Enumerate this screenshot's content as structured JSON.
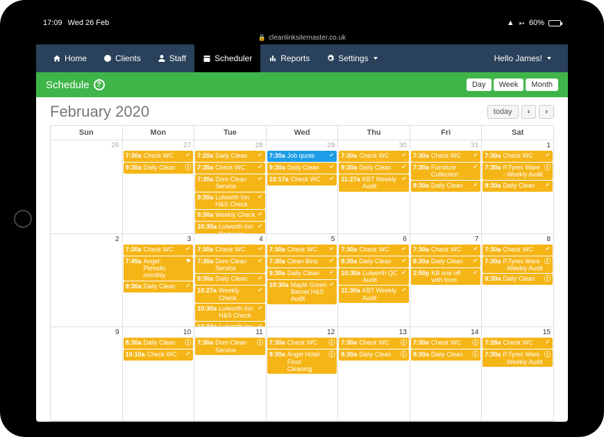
{
  "status": {
    "time": "17:09",
    "date": "Wed 26 Feb",
    "battery": "60%",
    "url": "cleanlinksitemaster.co.uk"
  },
  "nav": {
    "items": [
      {
        "label": "Home"
      },
      {
        "label": "Clients"
      },
      {
        "label": "Staff"
      },
      {
        "label": "Scheduler"
      },
      {
        "label": "Reports"
      },
      {
        "label": "Settings"
      }
    ],
    "greeting": "Hello James!"
  },
  "schedule_bar": {
    "title": "Schedule",
    "views": [
      "Day",
      "Week",
      "Month"
    ]
  },
  "calendar": {
    "title": "February 2020",
    "today_label": "today",
    "daynames": [
      "Sun",
      "Mon",
      "Tue",
      "Wed",
      "Thu",
      "Fri",
      "Sat"
    ],
    "weeks": [
      [
        {
          "num": "26",
          "cur": false,
          "events": []
        },
        {
          "num": "27",
          "cur": false,
          "events": [
            {
              "t": "7:30a",
              "txt": "Check WC",
              "ico": "check"
            },
            {
              "t": "9:30a",
              "txt": "Daily Clean",
              "ico": "info"
            }
          ]
        },
        {
          "num": "28",
          "cur": false,
          "events": [
            {
              "t": "7:20a",
              "txt": "Daily Clean",
              "ico": "check"
            },
            {
              "t": "7:30a",
              "txt": "Check WC",
              "ico": "check"
            },
            {
              "t": "7:30a",
              "txt": "Dom Clean Service",
              "ico": "check"
            },
            {
              "t": "9:30a",
              "txt": "Lulworth Inn H&S Check",
              "ico": "check"
            },
            {
              "t": "9:30a",
              "txt": "Weekly Check",
              "ico": "check"
            },
            {
              "t": "10:35a",
              "txt": "Lulworth Inn Bedroom Check",
              "ico": "check"
            }
          ]
        },
        {
          "num": "29",
          "cur": false,
          "events": [
            {
              "t": "7:30a",
              "txt": "Job quote",
              "ico": "check",
              "color": "blue"
            },
            {
              "t": "9:30a",
              "txt": "Daily Clean",
              "ico": "check"
            },
            {
              "t": "10:17a",
              "txt": "Check WC",
              "ico": "check"
            }
          ]
        },
        {
          "num": "30",
          "cur": false,
          "events": [
            {
              "t": "7:30a",
              "txt": "Check WC",
              "ico": "check"
            },
            {
              "t": "9:30a",
              "txt": "Daily Clean",
              "ico": "check"
            },
            {
              "t": "11:27a",
              "txt": "KBT Weekly Audit",
              "ico": "check"
            }
          ]
        },
        {
          "num": "31",
          "cur": false,
          "events": [
            {
              "t": "7:30a",
              "txt": "Check WC",
              "ico": "check"
            },
            {
              "t": "7:30a",
              "txt": "Furniture Collection",
              "ico": "check"
            },
            {
              "t": "9:30a",
              "txt": "Daily Clean",
              "ico": "check"
            }
          ]
        },
        {
          "num": "1",
          "cur": true,
          "events": [
            {
              "t": "7:30a",
              "txt": "Check WC",
              "ico": "check"
            },
            {
              "t": "7:30a",
              "txt": "P.Tyres Ware - Weekly Audit",
              "ico": "info"
            },
            {
              "t": "9:30a",
              "txt": "Daily Clean",
              "ico": "check"
            }
          ]
        }
      ],
      [
        {
          "num": "2",
          "cur": true,
          "events": []
        },
        {
          "num": "3",
          "cur": true,
          "events": [
            {
              "t": "7:30a",
              "txt": "Check WC",
              "ico": "check"
            },
            {
              "t": "7:45a",
              "txt": "Angel: Periodic monthly",
              "ico": "flag"
            },
            {
              "t": "9:30a",
              "txt": "Daily Clean",
              "ico": "check"
            }
          ]
        },
        {
          "num": "4",
          "cur": true,
          "events": [
            {
              "t": "7:30a",
              "txt": "Check WC",
              "ico": "check"
            },
            {
              "t": "7:30a",
              "txt": "Dom Clean Service",
              "ico": "check"
            },
            {
              "t": "9:30a",
              "txt": "Daily Clean",
              "ico": "check"
            },
            {
              "t": "10:27a",
              "txt": "Weekly Check",
              "ico": "check"
            },
            {
              "t": "10:30a",
              "txt": "Lulworth Inn H&S Check",
              "ico": "check"
            },
            {
              "t": "10:34a",
              "txt": "Lulworth Inn Bedroom Check",
              "ico": "check"
            }
          ]
        },
        {
          "num": "5",
          "cur": true,
          "events": [
            {
              "t": "7:30a",
              "txt": "Check WC",
              "ico": "check"
            },
            {
              "t": "7:30a",
              "txt": "Clean Bins",
              "ico": "check"
            },
            {
              "t": "9:30a",
              "txt": "Daily Clean",
              "ico": "check"
            },
            {
              "t": "10:30a",
              "txt": "Maple Green Barnet H&S Audit",
              "ico": "check"
            }
          ]
        },
        {
          "num": "6",
          "cur": true,
          "events": [
            {
              "t": "7:30a",
              "txt": "Check WC",
              "ico": "check"
            },
            {
              "t": "9:30a",
              "txt": "Daily Clean",
              "ico": "check"
            },
            {
              "t": "10:30a",
              "txt": "Lulworth QC Audit",
              "ico": "check"
            },
            {
              "t": "11:30a",
              "txt": "KBT Weekly Audit",
              "ico": "check"
            }
          ]
        },
        {
          "num": "7",
          "cur": true,
          "events": [
            {
              "t": "7:30a",
              "txt": "Check WC",
              "ico": "check"
            },
            {
              "t": "9:30a",
              "txt": "Daily Clean",
              "ico": "check"
            },
            {
              "t": "2:50p",
              "txt": "KB one off with form",
              "ico": "check"
            }
          ]
        },
        {
          "num": "8",
          "cur": true,
          "events": [
            {
              "t": "7:30a",
              "txt": "Check WC",
              "ico": "check"
            },
            {
              "t": "7:30a",
              "txt": "P.Tyres Ware - Weekly Audit",
              "ico": "info"
            },
            {
              "t": "9:30a",
              "txt": "Daily Clean",
              "ico": "info"
            }
          ]
        }
      ],
      [
        {
          "num": "9",
          "cur": true,
          "events": []
        },
        {
          "num": "10",
          "cur": true,
          "events": [
            {
              "t": "8:30a",
              "txt": "Daily Clean",
              "ico": "info"
            },
            {
              "t": "10:10a",
              "txt": "Check WC",
              "ico": "check"
            }
          ]
        },
        {
          "num": "11",
          "cur": true,
          "events": [
            {
              "t": "7:30a",
              "txt": "Dom Clean Service",
              "ico": "info"
            }
          ]
        },
        {
          "num": "12",
          "cur": true,
          "events": [
            {
              "t": "7:30a",
              "txt": "Check WC",
              "ico": "info"
            },
            {
              "t": "9:30a",
              "txt": "Angel Hotel Floor Cleaning",
              "ico": "info"
            }
          ]
        },
        {
          "num": "13",
          "cur": true,
          "events": [
            {
              "t": "7:30a",
              "txt": "Check WC",
              "ico": "info"
            },
            {
              "t": "9:30a",
              "txt": "Daily Clean",
              "ico": "info"
            }
          ]
        },
        {
          "num": "14",
          "cur": true,
          "events": [
            {
              "t": "7:30a",
              "txt": "Check WC",
              "ico": "info"
            },
            {
              "t": "9:30a",
              "txt": "Daily Clean",
              "ico": "info"
            }
          ]
        },
        {
          "num": "15",
          "cur": true,
          "events": [
            {
              "t": "7:28a",
              "txt": "Check WC",
              "ico": "check"
            },
            {
              "t": "7:30a",
              "txt": "P.Tyres Ware - Weekly Audit",
              "ico": "info"
            }
          ]
        }
      ]
    ]
  }
}
